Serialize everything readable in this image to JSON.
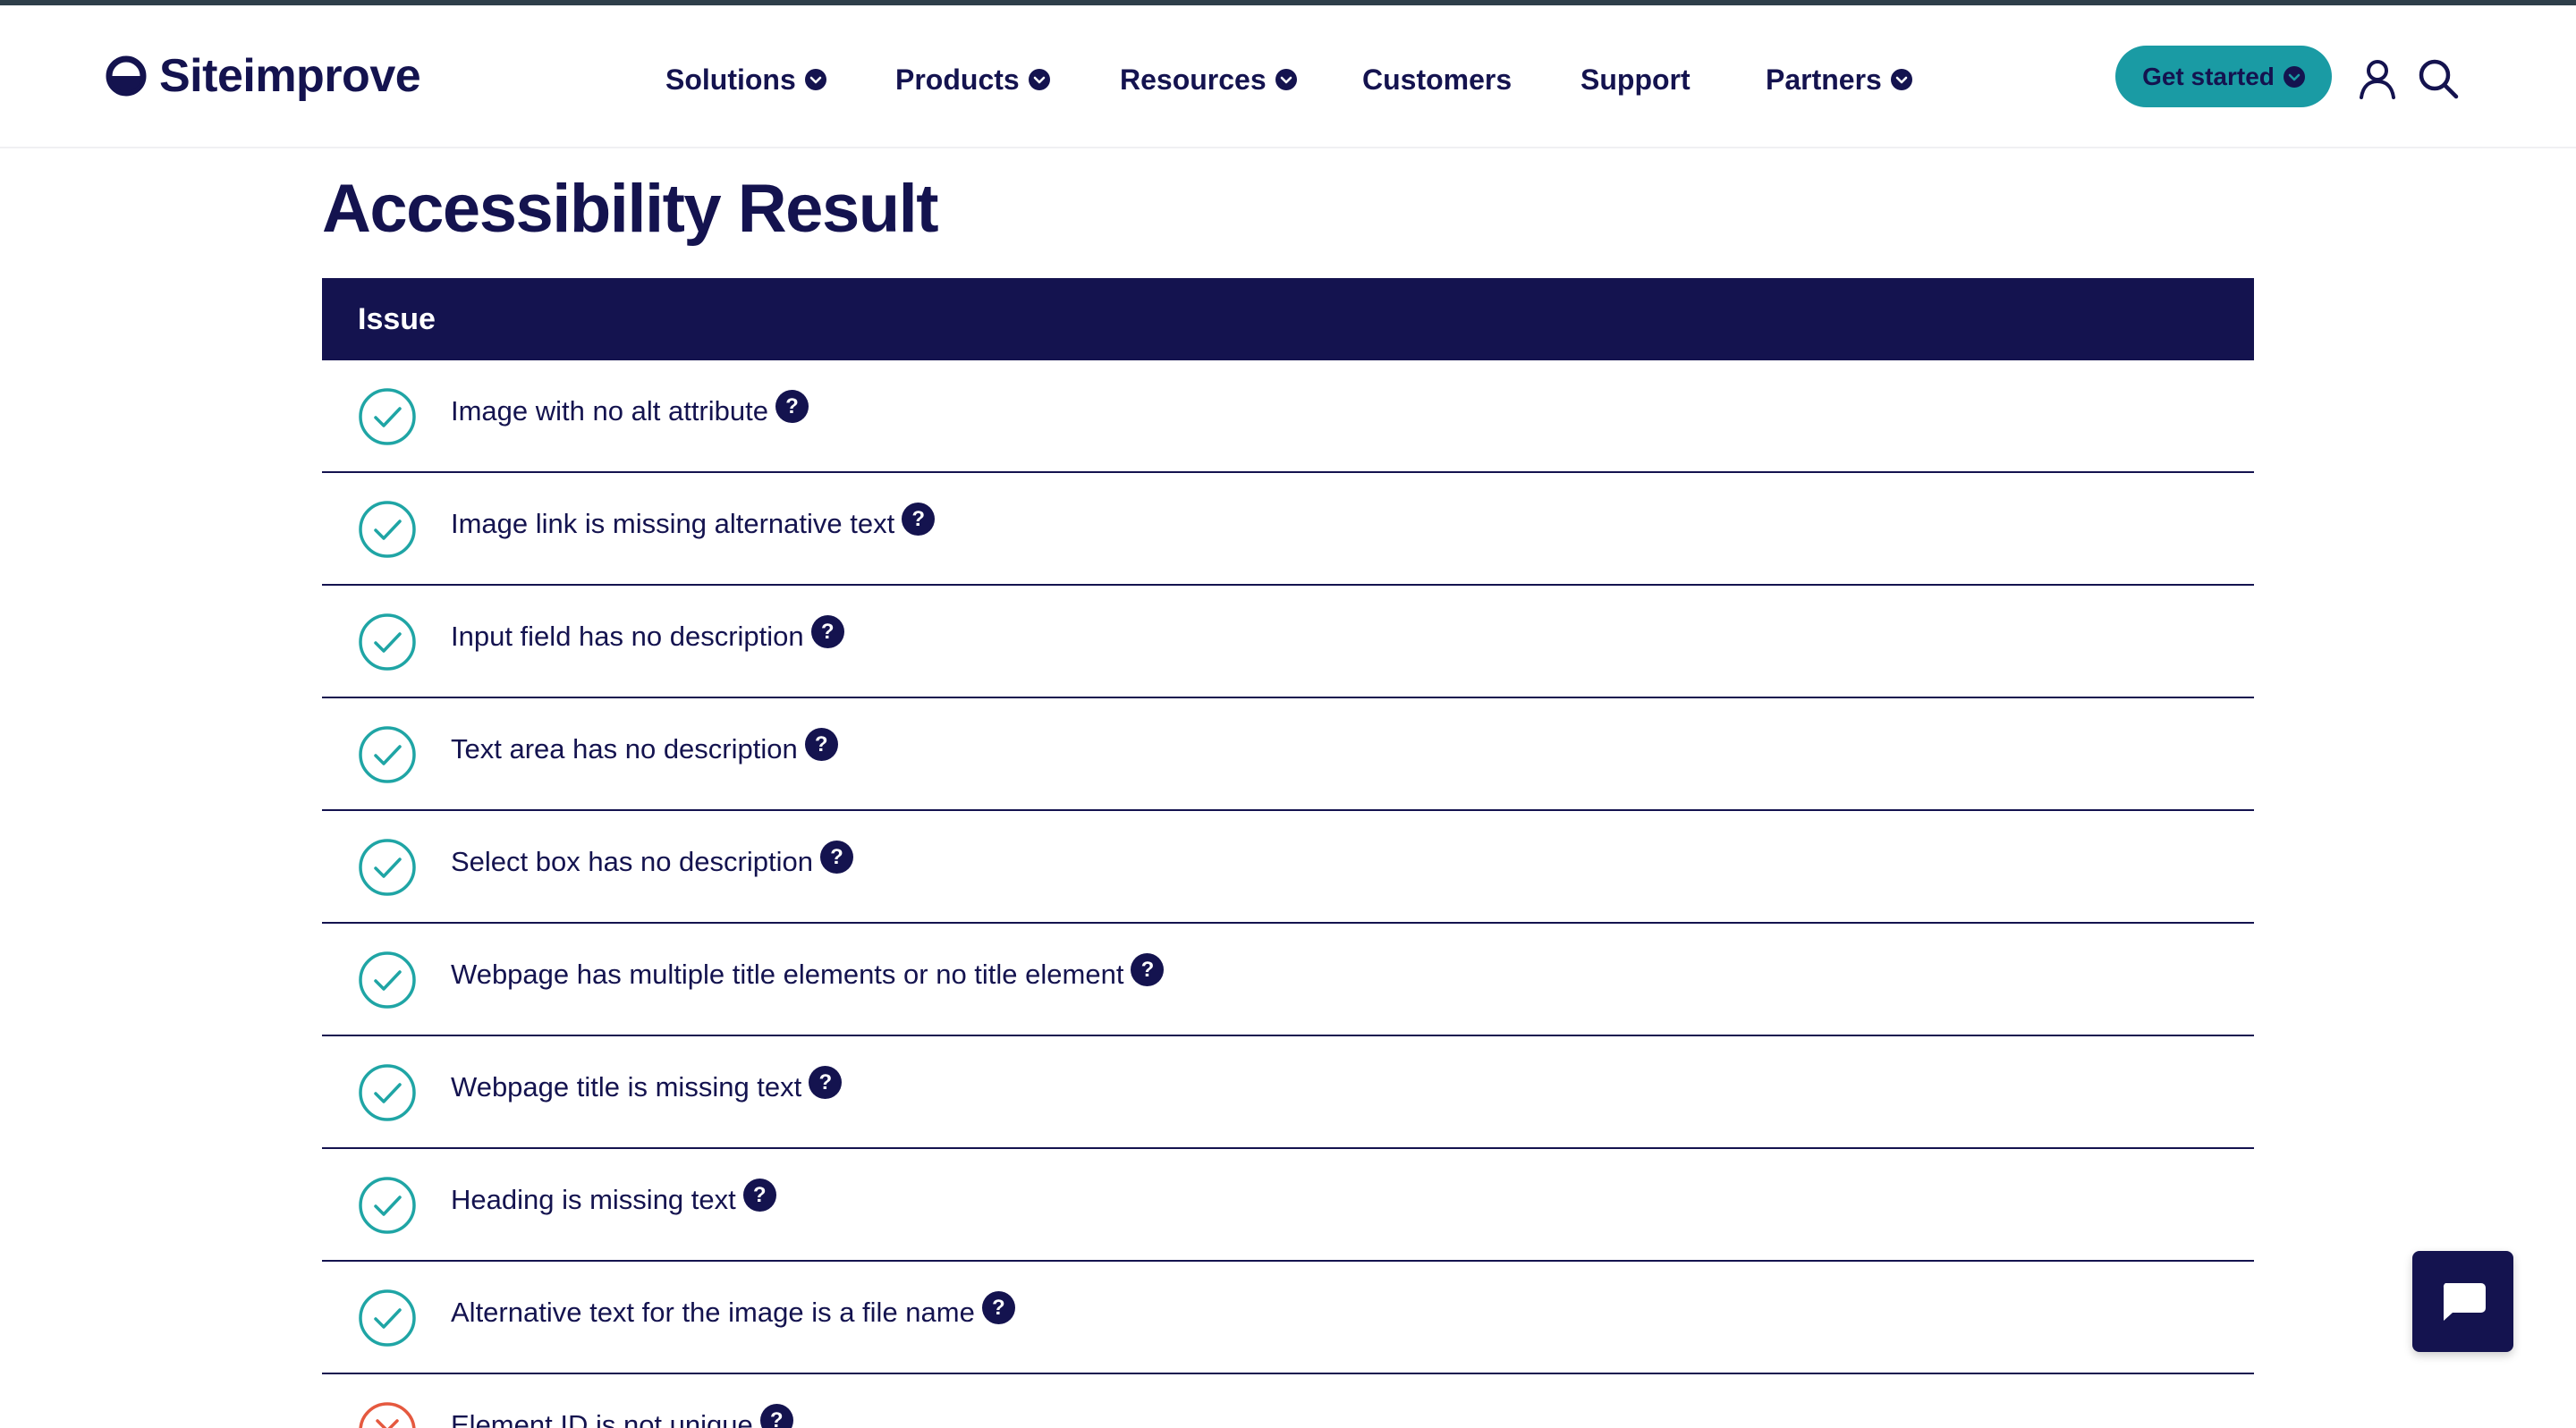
{
  "brand": {
    "name": "Siteimprove"
  },
  "nav": {
    "items": [
      {
        "label": "Solutions",
        "dropdown": true
      },
      {
        "label": "Products",
        "dropdown": true
      },
      {
        "label": "Resources",
        "dropdown": true
      },
      {
        "label": "Customers",
        "dropdown": false
      },
      {
        "label": "Support",
        "dropdown": false
      },
      {
        "label": "Partners",
        "dropdown": true
      }
    ],
    "cta_label": "Get started"
  },
  "page": {
    "title": "Accessibility Result"
  },
  "table": {
    "header": "Issue",
    "rows": [
      {
        "label": "Image with no alt attribute",
        "status": "pass"
      },
      {
        "label": "Image link is missing alternative text",
        "status": "pass"
      },
      {
        "label": "Input field has no description",
        "status": "pass"
      },
      {
        "label": "Text area has no description",
        "status": "pass"
      },
      {
        "label": "Select box has no description",
        "status": "pass"
      },
      {
        "label": "Webpage has multiple title elements or no title element",
        "status": "pass"
      },
      {
        "label": "Webpage title is missing text",
        "status": "pass"
      },
      {
        "label": "Heading is missing text",
        "status": "pass"
      },
      {
        "label": "Alternative text for the image is a file name",
        "status": "pass"
      },
      {
        "label": "Element ID is not unique",
        "status": "fail"
      }
    ],
    "help_glyph": "?"
  },
  "colors": {
    "navy": "#14134f",
    "teal": "#1a9ba4",
    "pass": "#1fa5a5",
    "fail": "#e5593f"
  },
  "icons": {
    "logo": "siteimprove-logo-icon",
    "user": "user-icon",
    "search": "search-icon",
    "pass": "check-circle-icon",
    "fail": "error-circle-icon",
    "help": "help-icon",
    "chat": "chat-icon"
  }
}
